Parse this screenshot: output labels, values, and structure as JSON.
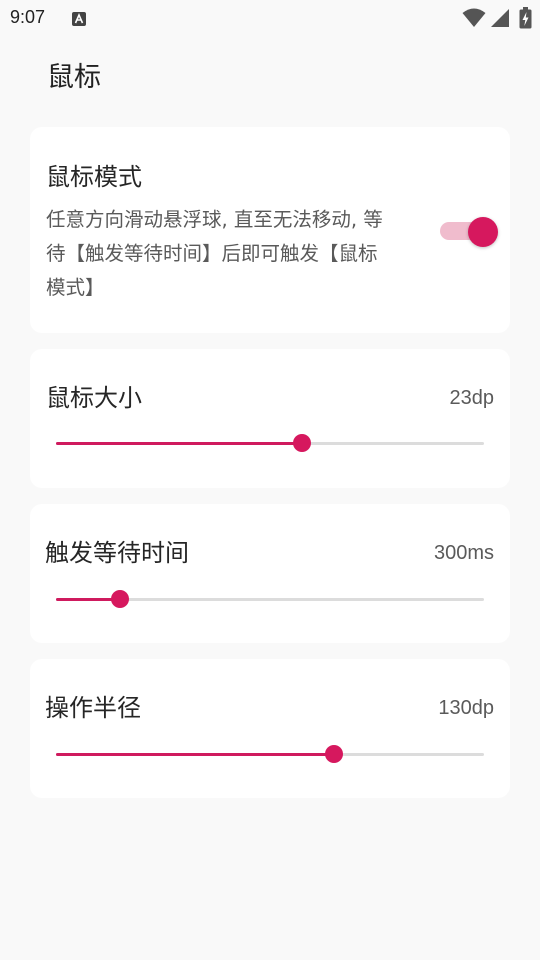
{
  "status_bar": {
    "time": "9:07",
    "notification_icon": "a-letter-notification-icon",
    "wifi_icon": "wifi-icon",
    "signal_icon": "cell-signal-icon",
    "battery_icon": "battery-charging-icon"
  },
  "page": {
    "title": "鼠标"
  },
  "mouse_mode": {
    "title": "鼠标模式",
    "description": "任意方向滑动悬浮球, 直至无法移动, 等待【触发等待时间】后即可触发【鼠标模式】",
    "enabled": true
  },
  "mouse_size": {
    "title": "鼠标大小",
    "value": "23dp",
    "slider_fraction": 0.575
  },
  "trigger_wait": {
    "title": "触发等待时间",
    "value": "300ms",
    "slider_fraction": 0.15
  },
  "operation_radius": {
    "title": "操作半径",
    "value": "130dp",
    "slider_fraction": 0.65
  },
  "colors": {
    "accent": "#d6185e",
    "accent_light": "#f0bccd",
    "track": "#dcdcdc",
    "card": "#ffffff",
    "background": "#f9f9f9"
  }
}
